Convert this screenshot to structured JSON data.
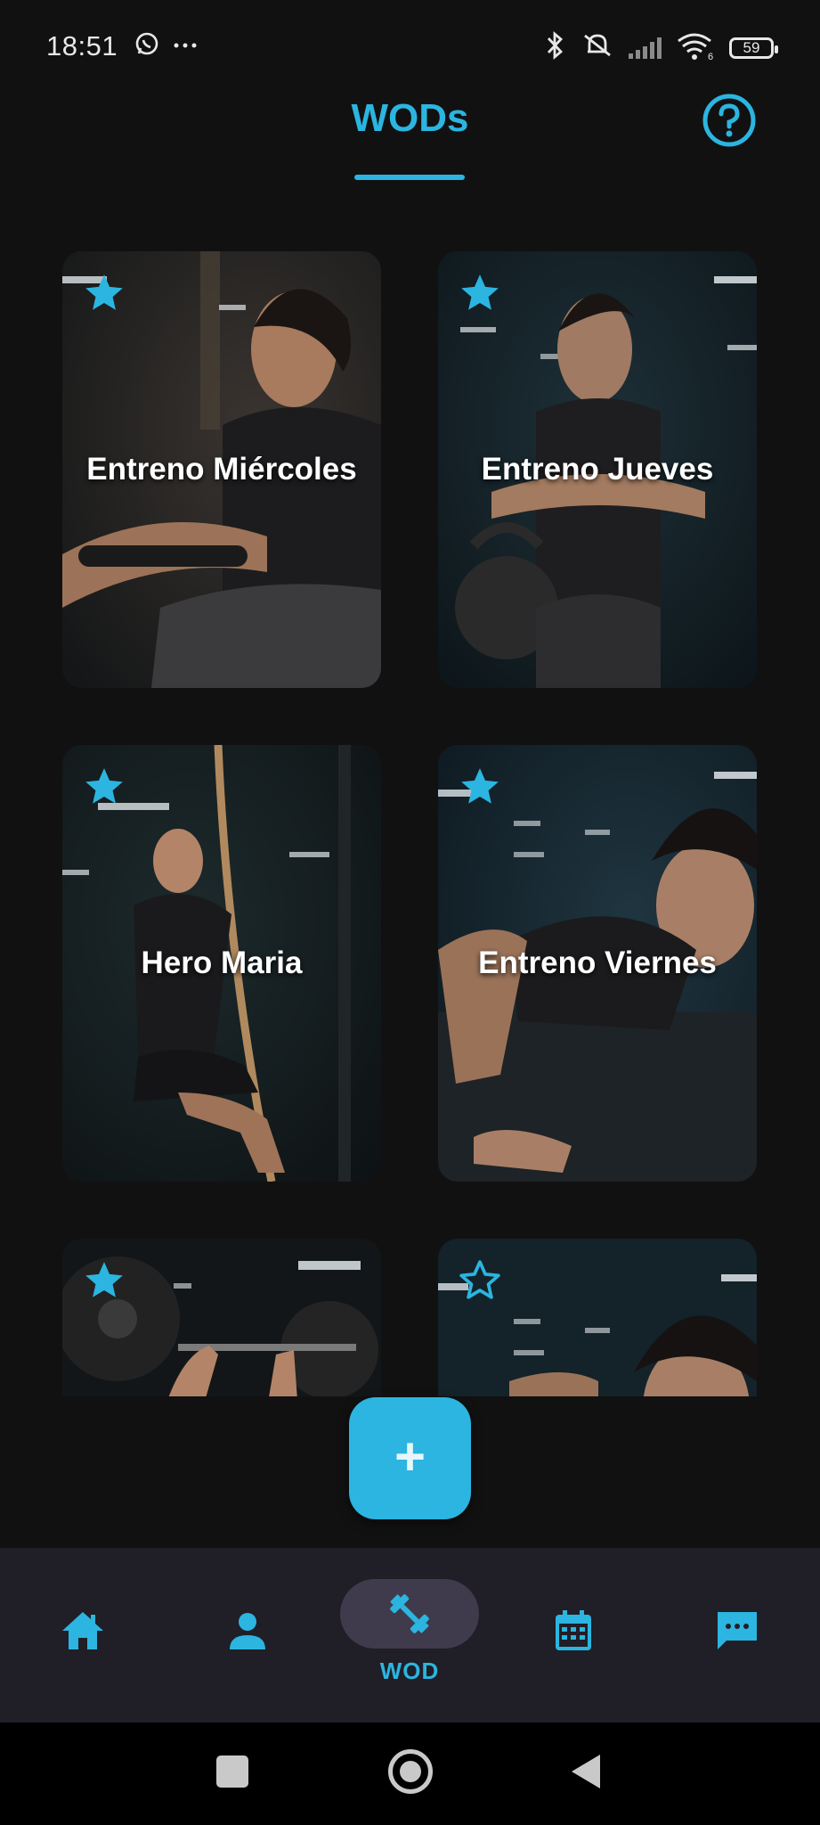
{
  "status_bar": {
    "time": "18:51",
    "battery": "59",
    "left_icons": [
      "whatsapp-icon",
      "more-dots-icon"
    ],
    "right_icons": [
      "bluetooth-icon",
      "silent-mode-icon",
      "signal-icon",
      "wifi-icon",
      "battery-icon"
    ]
  },
  "header": {
    "title": "WODs",
    "help_icon": "help-circle-icon"
  },
  "wods": [
    {
      "title": "Entreno Miércoles",
      "favorite": true
    },
    {
      "title": "Entreno Jueves",
      "favorite": true
    },
    {
      "title": "Hero Maria",
      "favorite": true
    },
    {
      "title": "Entreno Viernes",
      "favorite": true
    },
    {
      "title": "",
      "favorite": true
    },
    {
      "title": "",
      "favorite": false
    }
  ],
  "fab": {
    "icon": "plus-icon",
    "label": "+"
  },
  "bottom_nav": {
    "items": [
      {
        "icon": "home-icon",
        "label": ""
      },
      {
        "icon": "person-icon",
        "label": ""
      },
      {
        "icon": "dumbbell-icon",
        "label": "WOD",
        "active": true
      },
      {
        "icon": "calendar-icon",
        "label": ""
      },
      {
        "icon": "chat-icon",
        "label": ""
      }
    ]
  },
  "system_nav": [
    "recents-button",
    "home-button",
    "back-button"
  ],
  "colors": {
    "accent": "#2bb5e0",
    "background": "#111112",
    "nav_background": "#201e26",
    "active_pill": "#3f3b4c"
  }
}
